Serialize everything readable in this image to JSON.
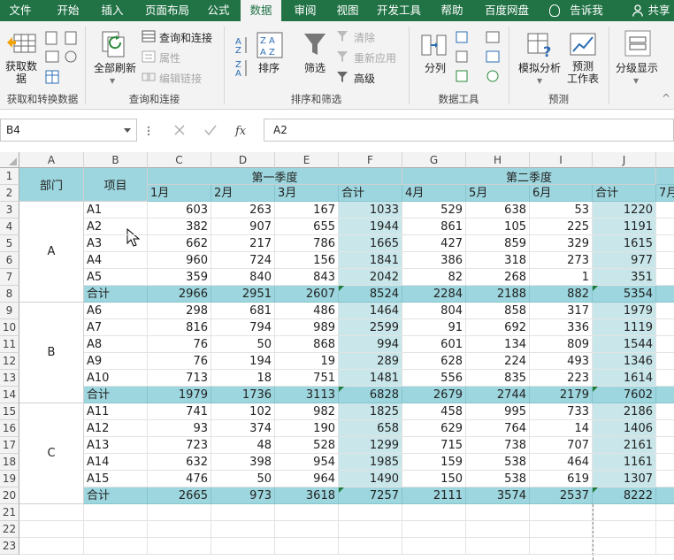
{
  "tabs": [
    "文件",
    "开始",
    "插入",
    "页面布局",
    "公式",
    "数据",
    "审阅",
    "视图",
    "开发工具",
    "帮助",
    "百度网盘",
    "告诉我",
    "共享"
  ],
  "active_tab": "数据",
  "ribbon": {
    "get_data": "获取数\n据",
    "refresh_all": "全部刷新",
    "queries_connections": "查询和连接",
    "properties": "属性",
    "edit_links": "编辑链接",
    "sort": "排序",
    "filter": "筛选",
    "clear": "清除",
    "reapply": "重新应用",
    "advanced": "高级",
    "text_to_columns": "分列",
    "what_if": "模拟分析",
    "forecast_sheet": "预测\n工作表",
    "outline": "分级显示",
    "groups": [
      "获取和转换数据",
      "查询和连接",
      "排序和筛选",
      "数据工具",
      "预测"
    ]
  },
  "formula_bar": {
    "name_box": "B4",
    "fx": "fx",
    "formula": "A2"
  },
  "columns": [
    "A",
    "B",
    "C",
    "D",
    "E",
    "F",
    "G",
    "H",
    "I",
    "J"
  ],
  "rows": [
    "1",
    "2",
    "3",
    "4",
    "5",
    "6",
    "7",
    "8",
    "9",
    "10",
    "11",
    "12",
    "13",
    "14",
    "15",
    "16",
    "17",
    "18",
    "19",
    "20",
    "21",
    "22",
    "23"
  ],
  "sheet": {
    "dept_header": "部门",
    "item_header": "项目",
    "q1": "第一季度",
    "q2": "第二季度",
    "month_headers": [
      "1月",
      "2月",
      "3月",
      "合计",
      "4月",
      "5月",
      "6月",
      "合计",
      "7月"
    ],
    "depts": [
      "A",
      "B",
      "C"
    ],
    "data_rows": [
      {
        "item": "A1",
        "vals": [
          "603",
          "263",
          "167",
          "1033",
          "529",
          "638",
          "53",
          "1220"
        ]
      },
      {
        "item": "A2",
        "vals": [
          "382",
          "907",
          "655",
          "1944",
          "861",
          "105",
          "225",
          "1191"
        ]
      },
      {
        "item": "A3",
        "vals": [
          "662",
          "217",
          "786",
          "1665",
          "427",
          "859",
          "329",
          "1615"
        ]
      },
      {
        "item": "A4",
        "vals": [
          "960",
          "724",
          "156",
          "1841",
          "386",
          "318",
          "273",
          "977"
        ]
      },
      {
        "item": "A5",
        "vals": [
          "359",
          "840",
          "843",
          "2042",
          "82",
          "268",
          "1",
          "351"
        ]
      },
      {
        "item": "合计",
        "vals": [
          "2966",
          "2951",
          "2607",
          "8524",
          "2284",
          "2188",
          "882",
          "5354"
        ]
      },
      {
        "item": "A6",
        "vals": [
          "298",
          "681",
          "486",
          "1464",
          "804",
          "858",
          "317",
          "1979"
        ]
      },
      {
        "item": "A7",
        "vals": [
          "816",
          "794",
          "989",
          "2599",
          "91",
          "692",
          "336",
          "1119"
        ]
      },
      {
        "item": "A8",
        "vals": [
          "76",
          "50",
          "868",
          "994",
          "601",
          "134",
          "809",
          "1544"
        ]
      },
      {
        "item": "A9",
        "vals": [
          "76",
          "194",
          "19",
          "289",
          "628",
          "224",
          "493",
          "1346"
        ]
      },
      {
        "item": "A10",
        "vals": [
          "713",
          "18",
          "751",
          "1481",
          "556",
          "835",
          "223",
          "1614"
        ]
      },
      {
        "item": "合计",
        "vals": [
          "1979",
          "1736",
          "3113",
          "6828",
          "2679",
          "2744",
          "2179",
          "7602"
        ]
      },
      {
        "item": "A11",
        "vals": [
          "741",
          "102",
          "982",
          "1825",
          "458",
          "995",
          "733",
          "2186"
        ]
      },
      {
        "item": "A12",
        "vals": [
          "93",
          "374",
          "190",
          "658",
          "629",
          "764",
          "14",
          "1406"
        ]
      },
      {
        "item": "A13",
        "vals": [
          "723",
          "48",
          "528",
          "1299",
          "715",
          "738",
          "707",
          "2161"
        ]
      },
      {
        "item": "A14",
        "vals": [
          "632",
          "398",
          "954",
          "1985",
          "159",
          "538",
          "464",
          "1161"
        ]
      },
      {
        "item": "A15",
        "vals": [
          "476",
          "50",
          "964",
          "1490",
          "150",
          "538",
          "619",
          "1307"
        ]
      },
      {
        "item": "合计",
        "vals": [
          "2665",
          "973",
          "3618",
          "7257",
          "2111",
          "3574",
          "2537",
          "8222"
        ]
      }
    ]
  }
}
